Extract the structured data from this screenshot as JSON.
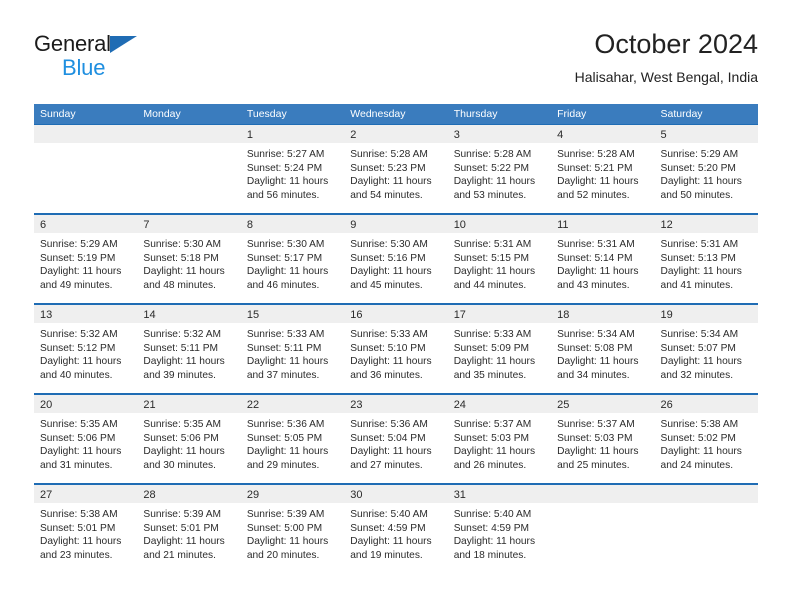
{
  "brand": {
    "name_top": "General",
    "name_bottom": "Blue",
    "accent_color": "#1f6cb4",
    "accent_light": "#1f8fe0"
  },
  "header": {
    "title": "October 2024",
    "subtitle": "Halisahar, West Bengal, India"
  },
  "calendar": {
    "header_bg": "#3a7cbe",
    "band_bg": "#efefef",
    "weekdays": [
      "Sunday",
      "Monday",
      "Tuesday",
      "Wednesday",
      "Thursday",
      "Friday",
      "Saturday"
    ],
    "weeks": [
      [
        {
          "day": "",
          "sunrise": "",
          "sunset": "",
          "daylight": "",
          "empty": true
        },
        {
          "day": "",
          "sunrise": "",
          "sunset": "",
          "daylight": "",
          "empty": true
        },
        {
          "day": "1",
          "sunrise": "Sunrise: 5:27 AM",
          "sunset": "Sunset: 5:24 PM",
          "daylight": "Daylight: 11 hours and 56 minutes.",
          "empty": false
        },
        {
          "day": "2",
          "sunrise": "Sunrise: 5:28 AM",
          "sunset": "Sunset: 5:23 PM",
          "daylight": "Daylight: 11 hours and 54 minutes.",
          "empty": false
        },
        {
          "day": "3",
          "sunrise": "Sunrise: 5:28 AM",
          "sunset": "Sunset: 5:22 PM",
          "daylight": "Daylight: 11 hours and 53 minutes.",
          "empty": false
        },
        {
          "day": "4",
          "sunrise": "Sunrise: 5:28 AM",
          "sunset": "Sunset: 5:21 PM",
          "daylight": "Daylight: 11 hours and 52 minutes.",
          "empty": false
        },
        {
          "day": "5",
          "sunrise": "Sunrise: 5:29 AM",
          "sunset": "Sunset: 5:20 PM",
          "daylight": "Daylight: 11 hours and 50 minutes.",
          "empty": false
        }
      ],
      [
        {
          "day": "6",
          "sunrise": "Sunrise: 5:29 AM",
          "sunset": "Sunset: 5:19 PM",
          "daylight": "Daylight: 11 hours and 49 minutes.",
          "empty": false
        },
        {
          "day": "7",
          "sunrise": "Sunrise: 5:30 AM",
          "sunset": "Sunset: 5:18 PM",
          "daylight": "Daylight: 11 hours and 48 minutes.",
          "empty": false
        },
        {
          "day": "8",
          "sunrise": "Sunrise: 5:30 AM",
          "sunset": "Sunset: 5:17 PM",
          "daylight": "Daylight: 11 hours and 46 minutes.",
          "empty": false
        },
        {
          "day": "9",
          "sunrise": "Sunrise: 5:30 AM",
          "sunset": "Sunset: 5:16 PM",
          "daylight": "Daylight: 11 hours and 45 minutes.",
          "empty": false
        },
        {
          "day": "10",
          "sunrise": "Sunrise: 5:31 AM",
          "sunset": "Sunset: 5:15 PM",
          "daylight": "Daylight: 11 hours and 44 minutes.",
          "empty": false
        },
        {
          "day": "11",
          "sunrise": "Sunrise: 5:31 AM",
          "sunset": "Sunset: 5:14 PM",
          "daylight": "Daylight: 11 hours and 43 minutes.",
          "empty": false
        },
        {
          "day": "12",
          "sunrise": "Sunrise: 5:31 AM",
          "sunset": "Sunset: 5:13 PM",
          "daylight": "Daylight: 11 hours and 41 minutes.",
          "empty": false
        }
      ],
      [
        {
          "day": "13",
          "sunrise": "Sunrise: 5:32 AM",
          "sunset": "Sunset: 5:12 PM",
          "daylight": "Daylight: 11 hours and 40 minutes.",
          "empty": false
        },
        {
          "day": "14",
          "sunrise": "Sunrise: 5:32 AM",
          "sunset": "Sunset: 5:11 PM",
          "daylight": "Daylight: 11 hours and 39 minutes.",
          "empty": false
        },
        {
          "day": "15",
          "sunrise": "Sunrise: 5:33 AM",
          "sunset": "Sunset: 5:11 PM",
          "daylight": "Daylight: 11 hours and 37 minutes.",
          "empty": false
        },
        {
          "day": "16",
          "sunrise": "Sunrise: 5:33 AM",
          "sunset": "Sunset: 5:10 PM",
          "daylight": "Daylight: 11 hours and 36 minutes.",
          "empty": false
        },
        {
          "day": "17",
          "sunrise": "Sunrise: 5:33 AM",
          "sunset": "Sunset: 5:09 PM",
          "daylight": "Daylight: 11 hours and 35 minutes.",
          "empty": false
        },
        {
          "day": "18",
          "sunrise": "Sunrise: 5:34 AM",
          "sunset": "Sunset: 5:08 PM",
          "daylight": "Daylight: 11 hours and 34 minutes.",
          "empty": false
        },
        {
          "day": "19",
          "sunrise": "Sunrise: 5:34 AM",
          "sunset": "Sunset: 5:07 PM",
          "daylight": "Daylight: 11 hours and 32 minutes.",
          "empty": false
        }
      ],
      [
        {
          "day": "20",
          "sunrise": "Sunrise: 5:35 AM",
          "sunset": "Sunset: 5:06 PM",
          "daylight": "Daylight: 11 hours and 31 minutes.",
          "empty": false
        },
        {
          "day": "21",
          "sunrise": "Sunrise: 5:35 AM",
          "sunset": "Sunset: 5:06 PM",
          "daylight": "Daylight: 11 hours and 30 minutes.",
          "empty": false
        },
        {
          "day": "22",
          "sunrise": "Sunrise: 5:36 AM",
          "sunset": "Sunset: 5:05 PM",
          "daylight": "Daylight: 11 hours and 29 minutes.",
          "empty": false
        },
        {
          "day": "23",
          "sunrise": "Sunrise: 5:36 AM",
          "sunset": "Sunset: 5:04 PM",
          "daylight": "Daylight: 11 hours and 27 minutes.",
          "empty": false
        },
        {
          "day": "24",
          "sunrise": "Sunrise: 5:37 AM",
          "sunset": "Sunset: 5:03 PM",
          "daylight": "Daylight: 11 hours and 26 minutes.",
          "empty": false
        },
        {
          "day": "25",
          "sunrise": "Sunrise: 5:37 AM",
          "sunset": "Sunset: 5:03 PM",
          "daylight": "Daylight: 11 hours and 25 minutes.",
          "empty": false
        },
        {
          "day": "26",
          "sunrise": "Sunrise: 5:38 AM",
          "sunset": "Sunset: 5:02 PM",
          "daylight": "Daylight: 11 hours and 24 minutes.",
          "empty": false
        }
      ],
      [
        {
          "day": "27",
          "sunrise": "Sunrise: 5:38 AM",
          "sunset": "Sunset: 5:01 PM",
          "daylight": "Daylight: 11 hours and 23 minutes.",
          "empty": false
        },
        {
          "day": "28",
          "sunrise": "Sunrise: 5:39 AM",
          "sunset": "Sunset: 5:01 PM",
          "daylight": "Daylight: 11 hours and 21 minutes.",
          "empty": false
        },
        {
          "day": "29",
          "sunrise": "Sunrise: 5:39 AM",
          "sunset": "Sunset: 5:00 PM",
          "daylight": "Daylight: 11 hours and 20 minutes.",
          "empty": false
        },
        {
          "day": "30",
          "sunrise": "Sunrise: 5:40 AM",
          "sunset": "Sunset: 4:59 PM",
          "daylight": "Daylight: 11 hours and 19 minutes.",
          "empty": false
        },
        {
          "day": "31",
          "sunrise": "Sunrise: 5:40 AM",
          "sunset": "Sunset: 4:59 PM",
          "daylight": "Daylight: 11 hours and 18 minutes.",
          "empty": false
        },
        {
          "day": "",
          "sunrise": "",
          "sunset": "",
          "daylight": "",
          "empty": true
        },
        {
          "day": "",
          "sunrise": "",
          "sunset": "",
          "daylight": "",
          "empty": true
        }
      ]
    ]
  }
}
